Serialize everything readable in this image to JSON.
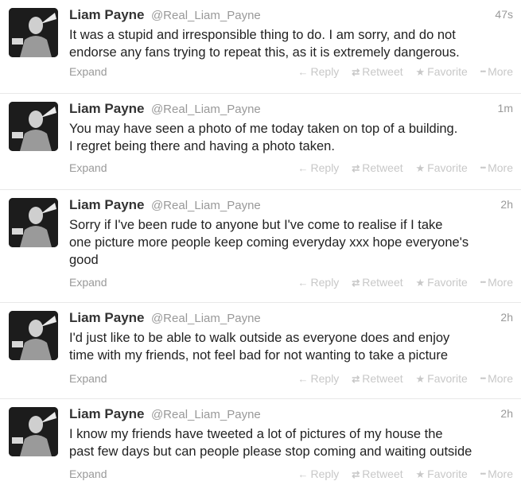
{
  "labels": {
    "expand": "Expand",
    "reply": "Reply",
    "retweet": "Retweet",
    "favorite": "Favorite",
    "more": "More"
  },
  "icons": {
    "reply": "reply-arrow-icon",
    "retweet": "retweet-icon",
    "favorite": "star-icon",
    "more": "ellipsis-icon"
  },
  "tweets": [
    {
      "name": "Liam Payne",
      "handle": "@Real_Liam_Payne",
      "time": "47s",
      "lines": [
        "It was a stupid and irresponsible thing to do. I am sorry, and do not",
        "endorse any fans trying to repeat this, as it is extremely dangerous."
      ]
    },
    {
      "name": "Liam Payne",
      "handle": "@Real_Liam_Payne",
      "time": "1m",
      "lines": [
        "You may have seen a photo of me today taken on top of a building.",
        "I regret being there and having a photo taken."
      ]
    },
    {
      "name": "Liam Payne",
      "handle": "@Real_Liam_Payne",
      "time": "2h",
      "lines": [
        "Sorry if I've been rude to anyone but I've come to realise if I take",
        "one picture more people keep coming everyday xxx hope everyone's",
        "good"
      ]
    },
    {
      "name": "Liam Payne",
      "handle": "@Real_Liam_Payne",
      "time": "2h",
      "lines": [
        "I'd just like to be able to walk outside as everyone does and enjoy",
        "time with my friends, not feel bad for not wanting to take a picture"
      ]
    },
    {
      "name": "Liam Payne",
      "handle": "@Real_Liam_Payne",
      "time": "2h",
      "lines": [
        "I know my friends have tweeted a lot of pictures of my house the",
        "past few days but can people please stop coming and waiting outside"
      ]
    }
  ]
}
